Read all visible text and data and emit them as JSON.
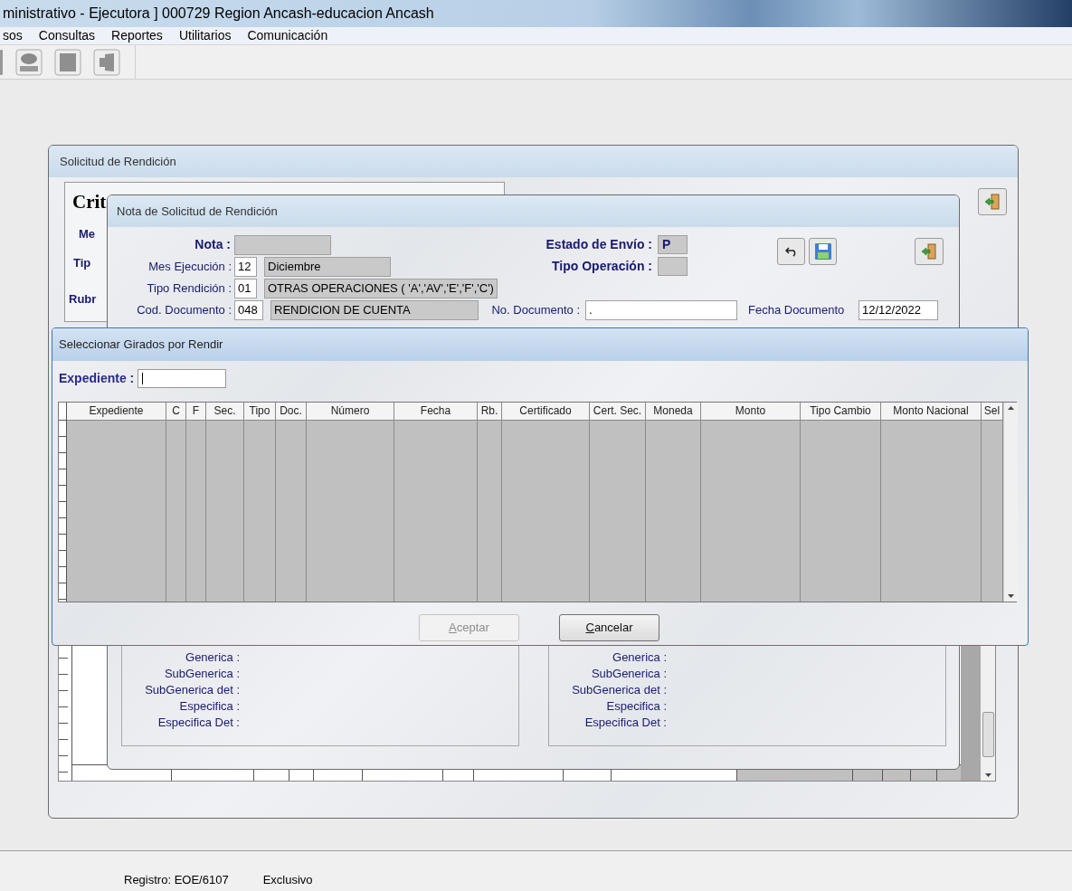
{
  "app_window": {
    "title": "ministrativo - Ejecutora ] 000729 Region Ancash-educacion Ancash",
    "menu": [
      "sos",
      "Consultas",
      "Reportes",
      "Utilitarios",
      "Comunicación"
    ]
  },
  "solicitud_window": {
    "title": "Solicitud de Rendición",
    "criteria_title": "Crit",
    "criteria_labels": [
      "Me",
      "Tip",
      "Rubr"
    ]
  },
  "nota_window": {
    "title": "Nota de Solicitud de Rendición",
    "nota_label": "Nota :",
    "rows": [
      {
        "label": "Mes Ejecución :",
        "code": "12",
        "description": "Diciembre"
      },
      {
        "label": "Tipo Rendición :",
        "code": "01",
        "description": "OTRAS OPERACIONES ( 'A','AV','E','F','C')"
      },
      {
        "label": "Cod. Documento :",
        "code": "048",
        "description": "RENDICION DE CUENTA"
      }
    ],
    "no_documento": {
      "label": "No. Documento :",
      "value": "."
    },
    "fecha_documento": {
      "label": "Fecha Documento",
      "value": "12/12/2022"
    },
    "estado_envio": {
      "label": "Estado de Envío :",
      "value": "P"
    },
    "tipo_operacion": {
      "label": "Tipo Operación :"
    },
    "detail_panels": [
      {
        "labels": [
          "Generica :",
          "SubGenerica :",
          "SubGenerica det :",
          "Especifica :",
          "Especifica Det :"
        ]
      },
      {
        "labels": [
          "Generica :",
          "SubGenerica :",
          "SubGenerica det :",
          "Especifica :",
          "Especifica Det :"
        ]
      }
    ]
  },
  "dialog": {
    "title": "Seleccionar Girados por Rendir",
    "search": {
      "label": "Expediente :"
    },
    "columns": [
      "Expediente",
      "C",
      "F",
      "Sec.",
      "Tipo",
      "Doc.",
      "Número",
      "Fecha",
      "Rb.",
      "Certificado",
      "Cert. Sec.",
      "Moneda",
      "Monto",
      "Tipo Cambio",
      "Monto Nacional",
      "Sel"
    ],
    "buttons": [
      {
        "label": "Aceptar",
        "disabled": true
      },
      {
        "label": "Cancelar",
        "disabled": false
      }
    ]
  },
  "status_bar": [
    "Registro: EOE/6107",
    "Exclusivo"
  ]
}
